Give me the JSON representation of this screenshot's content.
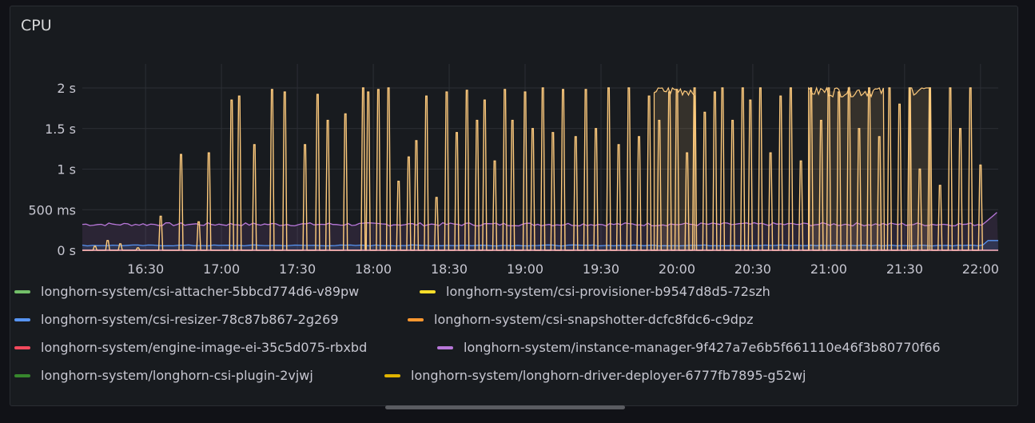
{
  "panel": {
    "title": "CPU"
  },
  "chart_data": {
    "type": "line",
    "title": "CPU",
    "y_ticks": [
      {
        "label": "2 s",
        "value": 2.0
      },
      {
        "label": "1.5 s",
        "value": 1.5
      },
      {
        "label": "1 s",
        "value": 1.0
      },
      {
        "label": "500 ms",
        "value": 0.5
      },
      {
        "label": "0 s",
        "value": 0.0
      }
    ],
    "x_ticks": [
      "16:30",
      "17:00",
      "17:30",
      "18:00",
      "18:30",
      "19:00",
      "19:30",
      "20:00",
      "20:30",
      "21:00",
      "21:30",
      "22:00"
    ],
    "x_range": [
      "16:05",
      "22:07"
    ],
    "ylim": [
      0,
      2.0
    ],
    "grid": true,
    "legend": "bottom",
    "series": [
      {
        "name": "longhorn-system/csi-attacher-5bbcd774d6-v89pw",
        "color": "#73bf69",
        "level": 0.0
      },
      {
        "name": "longhorn-system/csi-provisioner-b9547d8d5-72szh",
        "color": "#fade2a",
        "level": 0.0
      },
      {
        "name": "longhorn-system/csi-resizer-78c87b867-2g269",
        "color": "#5794f2",
        "level": 0.06,
        "end_value": 0.12
      },
      {
        "name": "longhorn-system/csi-snapshotter-dcfc8fdc6-c9dpz",
        "color": "#ff9830",
        "level": 0.0
      },
      {
        "name": "longhorn-system/engine-image-ei-35c5d075-rbxbd",
        "color": "#f2495c",
        "level": 0.0
      },
      {
        "name": "longhorn-system/instance-manager-9f427a7e6b5f661110e46f3b80770f66",
        "color": "#b877d9",
        "level": 0.32,
        "end_value": 0.48
      },
      {
        "name": "longhorn-system/longhorn-csi-plugin-2vjwj",
        "color": "#37872d",
        "level": 0.0
      },
      {
        "name": "longhorn-system/longhorn-driver-deployer-6777fb7895-g52wj",
        "color": "#e0b400",
        "level": 0.0
      }
    ],
    "spiky_series": {
      "name": "longhorn-system/csi-provisioner-b9547d8d5-72szh",
      "color": "#ffcb7d",
      "spikes": [
        [
          "16:10",
          0.05
        ],
        [
          "16:15",
          0.12
        ],
        [
          "16:20",
          0.08
        ],
        [
          "16:27",
          0.03
        ],
        [
          "16:36",
          0.42
        ],
        [
          "16:44",
          1.18
        ],
        [
          "16:51",
          0.35
        ],
        [
          "16:55",
          1.2
        ],
        [
          "17:04",
          1.85
        ],
        [
          "17:07",
          1.9
        ],
        [
          "17:13",
          1.3
        ],
        [
          "17:20",
          1.98
        ],
        [
          "17:25",
          1.95
        ],
        [
          "17:33",
          1.3
        ],
        [
          "17:38",
          1.92
        ],
        [
          "17:42",
          1.6
        ],
        [
          "17:49",
          1.68
        ],
        [
          "17:56",
          2.0
        ],
        [
          "17:58",
          1.95
        ],
        [
          "18:02",
          1.98
        ],
        [
          "18:06",
          2.0
        ],
        [
          "18:10",
          0.85
        ],
        [
          "18:14",
          1.15
        ],
        [
          "18:17",
          1.35
        ],
        [
          "18:21",
          1.9
        ],
        [
          "18:25",
          0.65
        ],
        [
          "18:29",
          1.95
        ],
        [
          "18:33",
          1.45
        ],
        [
          "18:37",
          1.97
        ],
        [
          "18:41",
          1.6
        ],
        [
          "18:44",
          1.85
        ],
        [
          "18:48",
          1.1
        ],
        [
          "18:52",
          1.98
        ],
        [
          "18:55",
          1.6
        ],
        [
          "19:00",
          1.95
        ],
        [
          "19:03",
          1.5
        ],
        [
          "19:07",
          2.0
        ],
        [
          "19:11",
          1.45
        ],
        [
          "19:15",
          1.98
        ],
        [
          "19:20",
          1.4
        ],
        [
          "19:24",
          1.98
        ],
        [
          "19:28",
          1.5
        ],
        [
          "19:33",
          2.0
        ],
        [
          "19:37",
          1.3
        ],
        [
          "19:41",
          2.0
        ],
        [
          "19:45",
          1.4
        ],
        [
          "19:49",
          1.9
        ],
        [
          "19:53",
          1.6
        ],
        [
          "19:57",
          1.95
        ],
        [
          "20:00",
          1.98
        ],
        [
          "20:04",
          1.2
        ],
        [
          "20:07",
          2.0
        ],
        [
          "20:11",
          1.7
        ],
        [
          "20:15",
          1.95
        ],
        [
          "20:18",
          2.0
        ],
        [
          "20:22",
          1.6
        ],
        [
          "20:26",
          2.0
        ],
        [
          "20:29",
          1.85
        ],
        [
          "20:33",
          2.0
        ],
        [
          "20:37",
          1.2
        ],
        [
          "20:41",
          1.9
        ],
        [
          "20:45",
          2.0
        ],
        [
          "20:49",
          1.1
        ],
        [
          "20:53",
          2.0
        ],
        [
          "20:57",
          1.6
        ],
        [
          "21:00",
          2.0
        ],
        [
          "21:04",
          1.95
        ],
        [
          "21:08",
          2.0
        ],
        [
          "21:12",
          1.5
        ],
        [
          "21:16",
          2.0
        ],
        [
          "21:20",
          1.4
        ],
        [
          "21:24",
          2.0
        ],
        [
          "21:28",
          1.8
        ],
        [
          "21:32",
          2.0
        ],
        [
          "21:36",
          1.0
        ],
        [
          "21:40",
          2.0
        ],
        [
          "21:44",
          0.8
        ],
        [
          "21:48",
          2.0
        ],
        [
          "21:52",
          1.5
        ],
        [
          "21:56",
          2.0
        ],
        [
          "22:00",
          1.05
        ]
      ],
      "plateaus": [
        [
          "19:51",
          "20:07",
          1.97
        ],
        [
          "20:52",
          "21:22",
          1.96
        ],
        [
          "21:32",
          "21:40",
          1.98
        ]
      ]
    }
  }
}
